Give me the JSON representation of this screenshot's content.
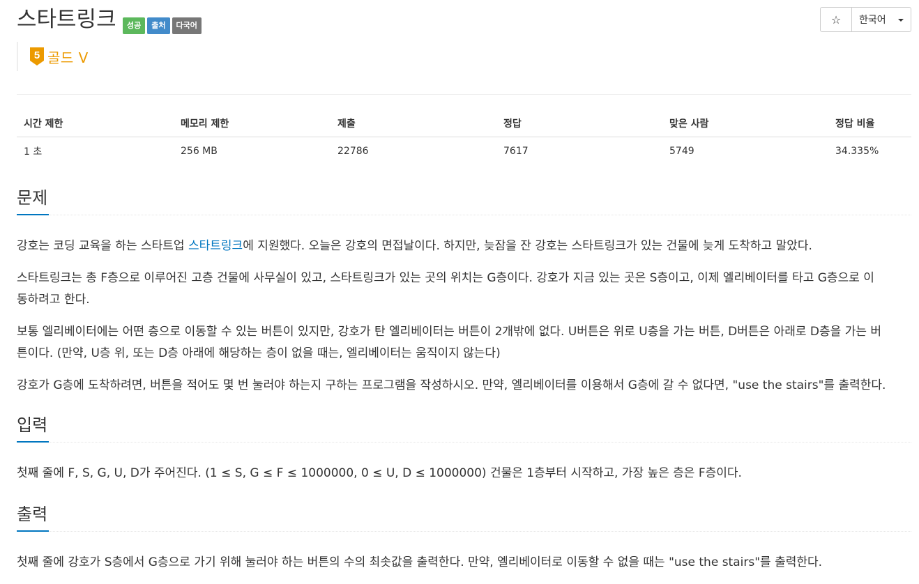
{
  "problem": {
    "title": "스타트링크",
    "labels": [
      "성공",
      "출처",
      "다국어"
    ],
    "tier_number": "5",
    "tier_text": "골드 V"
  },
  "toolbar": {
    "star_icon": "☆",
    "language": "한국어"
  },
  "stats": {
    "headers": [
      "시간 제한",
      "메모리 제한",
      "제출",
      "정답",
      "맞은 사람",
      "정답 비율"
    ],
    "values": [
      "1 초",
      "256 MB",
      "22786",
      "7617",
      "5749",
      "34.335%"
    ]
  },
  "sections": {
    "problem_heading": "문제",
    "p1_before": "강호는 코딩 교육을 하는 스타트업 ",
    "p1_link": "스타트링크",
    "p1_after": "에 지원했다. 오늘은 강호의 면접날이다. 하지만, 늦잠을 잔 강호는 스타트링크가 있는 건물에 늦게 도착하고 말았다.",
    "p2_line1": "스타트링크는 총 F층으로 이루어진 고층 건물에 사무실이 있고, 스타트링크가 있는 곳의 위치는 G층이다. 강호가 지금 있는 곳은 S층이고, 이제 엘리베이터를 타고 G층으로 이",
    "p2_line2": "동하려고 한다.",
    "p3_line1": "보통 엘리베이터에는 어떤 층으로 이동할 수 있는 버튼이 있지만, 강호가 탄 엘리베이터는 버튼이 2개밖에 없다. U버튼은 위로 U층을 가는 버튼, D버튼은 아래로 D층을 가는 버",
    "p3_line2": "튼이다. (만약, U층 위, 또는 D층 아래에 해당하는 층이 없을 때는, 엘리베이터는 움직이지 않는다)",
    "p4": "강호가 G층에 도착하려면, 버튼을 적어도 몇 번 눌러야 하는지 구하는 프로그램을 작성하시오. 만약, 엘리베이터를 이용해서 G층에 갈 수 없다면, \"use the stairs\"를 출력한다.",
    "input_heading": "입력",
    "input_text": "첫째 줄에 F, S, G, U, D가 주어진다. (1 ≤ S, G ≤ F ≤ 1000000, 0 ≤ U, D ≤ 1000000) 건물은 1층부터 시작하고, 가장 높은 층은 F층이다.",
    "output_heading": "출력",
    "output_text": "첫째 줄에 강호가 S층에서 G층으로 가기 위해 눌러야 하는 버튼의 수의 최솟값을 출력한다. 만약, 엘리베이터로 이동할 수 없을 때는 \"use the stairs\"를 출력한다."
  },
  "colors": {
    "success": "#5cb85c",
    "source": "#428bca",
    "multilang": "#777777",
    "gold": "#ec9a00",
    "link": "#0076c0"
  }
}
